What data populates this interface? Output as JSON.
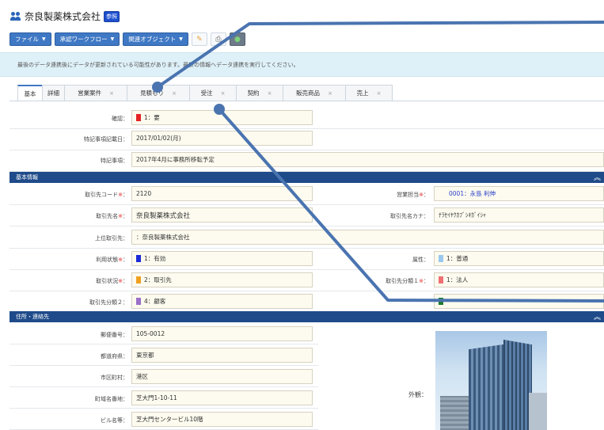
{
  "header": {
    "title": "奈良製薬株式会社",
    "badge": "参照"
  },
  "toolbar": {
    "file": "ファイル",
    "workflow": "承認ワークフロー",
    "related": "関連オブジェクト"
  },
  "notice": "最後のデータ連携後にデータが更新されている可能性があります。最新の情報へデータ連携を実行してください。",
  "tabs": [
    {
      "label": "基本",
      "close": ""
    },
    {
      "label": "詳細",
      "close": ""
    },
    {
      "label": "営業案件",
      "close": "×"
    },
    {
      "label": "見積もり",
      "close": "×"
    },
    {
      "label": "受注",
      "close": "×"
    },
    {
      "label": "契約",
      "close": "×"
    },
    {
      "label": "販売商品",
      "close": "×"
    },
    {
      "label": "売上",
      "close": "×"
    }
  ],
  "top_fields": {
    "confirm_label": "確認：",
    "confirm_value": "1：要",
    "note_date_label": "特記事項記載日：",
    "note_date_value": "2017/01/02(月)",
    "note_label": "特記事項：",
    "note_value": "2017年4月に事務所移転予定"
  },
  "section_basic": "基本情報",
  "basic": {
    "code_label": "取引先コード",
    "code_value": "2120",
    "sales_label": "営業担当",
    "sales_value": "0001：永島 利伸",
    "name_label": "取引先名",
    "name_value": "奈良製薬株式会社",
    "kana_label": "取引先名カナ：",
    "kana_value": "ﾅﾗｾｲﾔｸｶﾌﾞｼｷｶﾞｲｼｬ",
    "parent_label": "上位取引先：",
    "parent_value": "：奈良製薬株式会社",
    "usage_label": "利用状態",
    "usage_value": "1：有効",
    "attr_label": "属性：",
    "attr_value": "1：普通",
    "status_label": "取引状況",
    "status_value": "2：取引先",
    "class1_label": "取引先分類１",
    "class1_value": "1：法人",
    "class2_label": "取引先分類２：",
    "class2_value": "4：顧客",
    "req_mark": "※",
    "colon": "："
  },
  "section_address": "住所・連絡先",
  "address": {
    "zip_label": "郵便番号：",
    "zip_value": "105-0012",
    "pref_label": "都道府県：",
    "pref_value": "東京都",
    "city_label": "市区町村：",
    "city_value": "港区",
    "street_label": "町域名番地：",
    "street_value": "芝大門1-10-11",
    "building_label": "ビル名等：",
    "building_value": "芝大門センタービル10階",
    "exterior_label": "外観："
  },
  "colors": {
    "confirm_sq": "#e52222",
    "usage_sq": "#1a2ad8",
    "attr_sq": "#9ac8ee",
    "status_sq": "#f0a020",
    "class1_sq": "#ee7070",
    "class2_sq": "#9a70c8",
    "overlay_line": "#4a74b0"
  }
}
